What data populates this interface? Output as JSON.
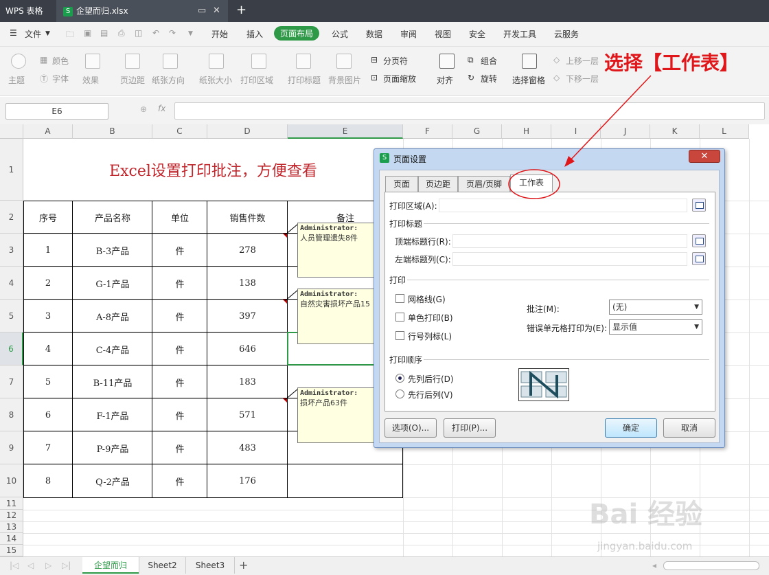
{
  "titlebar": {
    "app_name": "WPS 表格",
    "file_name": "企望而归.xlsx",
    "new_tab": "+"
  },
  "menu": {
    "file": "文件",
    "items": [
      "开始",
      "插入",
      "页面布局",
      "公式",
      "数据",
      "审阅",
      "视图",
      "安全",
      "开发工具",
      "云服务"
    ],
    "active": "页面布局"
  },
  "ribbon": {
    "theme": "主题",
    "color": "颜色",
    "font": "字体",
    "effect": "效果",
    "margin": "页边距",
    "orientation": "纸张方向",
    "size": "纸张大小",
    "print_area": "打印区域",
    "print_title": "打印标题",
    "background": "背景图片",
    "page_break": "分页符",
    "page_zoom": "页面缩放",
    "align": "对齐",
    "group": "组合",
    "rotate": "旋转",
    "selection_pane": "选择窗格",
    "bring_forward": "上移一层",
    "send_backward": "下移一层"
  },
  "formula": {
    "cell_ref": "E6",
    "fx": "fx"
  },
  "columns": [
    "A",
    "B",
    "C",
    "D",
    "E",
    "F",
    "G",
    "H",
    "I",
    "J",
    "K",
    "L"
  ],
  "rows": [
    "1",
    "2",
    "3",
    "4",
    "5",
    "6",
    "7",
    "8",
    "9",
    "10",
    "11",
    "12",
    "13",
    "14",
    "15"
  ],
  "sheet": {
    "title": "Excel设置打印批注，方便查看",
    "headers": [
      "序号",
      "产品名称",
      "单位",
      "销售件数",
      "备注"
    ],
    "data": [
      [
        "1",
        "B-3产品",
        "件",
        "278"
      ],
      [
        "2",
        "G-1产品",
        "件",
        "138"
      ],
      [
        "3",
        "A-8产品",
        "件",
        "397"
      ],
      [
        "4",
        "C-4产品",
        "件",
        "646"
      ],
      [
        "5",
        "B-11产品",
        "件",
        "183"
      ],
      [
        "6",
        "F-1产品",
        "件",
        "571"
      ],
      [
        "7",
        "P-9产品",
        "件",
        "483"
      ],
      [
        "8",
        "Q-2产品",
        "件",
        "176"
      ]
    ]
  },
  "comments": [
    {
      "author": "Administrator:",
      "text": "人员管理遗失8件"
    },
    {
      "author": "Administrator:",
      "text": "自然灾害损坏产品15"
    },
    {
      "author": "Administrator:",
      "text": "损坏产品63件"
    }
  ],
  "sheet_tabs": [
    "企望而归",
    "Sheet2",
    "Sheet3"
  ],
  "dialog": {
    "title": "页面设置",
    "close": "✕",
    "tabs": [
      "页面",
      "页边距",
      "页眉/页脚",
      "工作表"
    ],
    "active_tab": "工作表",
    "print_area_label": "打印区域(A):",
    "print_titles_section": "打印标题",
    "top_rows_label": "顶端标题行(R):",
    "left_cols_label": "左端标题列(C):",
    "print_section": "打印",
    "gridlines": "网格线(G)",
    "mono": "单色打印(B)",
    "rowcol": "行号列标(L)",
    "comments_label": "批注(M):",
    "comments_value": "(无)",
    "errors_label": "错误单元格打印为(E):",
    "errors_value": "显示值",
    "order_section": "打印顺序",
    "order_down": "先列后行(D)",
    "order_over": "先行后列(V)",
    "options_btn": "选项(O)...",
    "print_btn": "打印(P)...",
    "ok_btn": "确定",
    "cancel_btn": "取消"
  },
  "annotation": "选择【工作表】",
  "watermark": {
    "brand": "Bai 经验",
    "url": "jingyan.baidu.com"
  },
  "colors": {
    "brand_green": "#2e9a48",
    "annotation_red": "#e0171a",
    "comment_bg": "#ffffe1"
  }
}
